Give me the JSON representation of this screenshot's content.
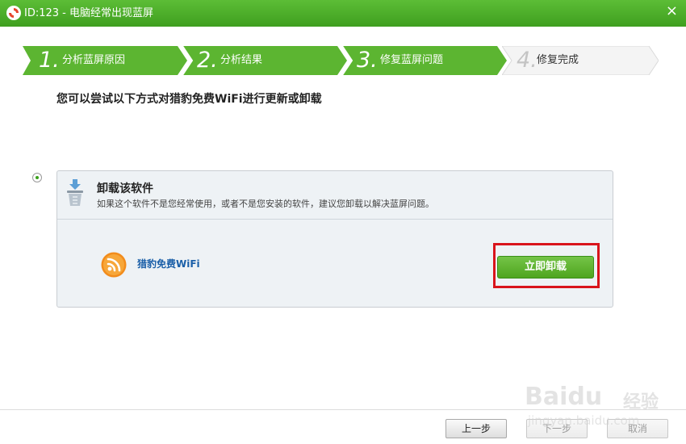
{
  "window": {
    "title": "ID:123 - 电脑经常出现蓝屏",
    "close_symbol": "×"
  },
  "steps": [
    {
      "number": "1.",
      "label": "分析蓝屏原因",
      "state": "done"
    },
    {
      "number": "2.",
      "label": "分析结果",
      "state": "done"
    },
    {
      "number": "3.",
      "label": "修复蓝屏问题",
      "state": "done"
    },
    {
      "number": "4.",
      "label": "修复完成",
      "state": "current"
    }
  ],
  "main": {
    "headline": "您可以尝试以下方式对猎豹免费WiFi进行更新或卸载"
  },
  "option": {
    "selected": true,
    "title": "卸载该软件",
    "description": "如果这个软件不是您经常使用，或者不是您安装的软件，建议您卸载以解决蓝屏问题。",
    "app_name": "猎豹免费WiFi",
    "action_label": "立即卸载"
  },
  "footer": {
    "prev_label": "上一步",
    "next_label": "下一步",
    "cancel_label": "取消"
  },
  "watermark": {
    "brand": "Baidu",
    "cn": "经验",
    "url": "jingyan.baidu.com"
  },
  "colors": {
    "title_bar": "#4cae2a",
    "step_done": "#5cb531",
    "step_current": "#f4f4f4",
    "accent_button": "#5db431",
    "highlight_border": "#d9141b",
    "app_name": "#1a5fa8"
  },
  "icons": {
    "app": "lifebuoy-icon",
    "close": "close-icon",
    "option": "recycle-bin-icon",
    "app_logo": "wifi-icon"
  }
}
